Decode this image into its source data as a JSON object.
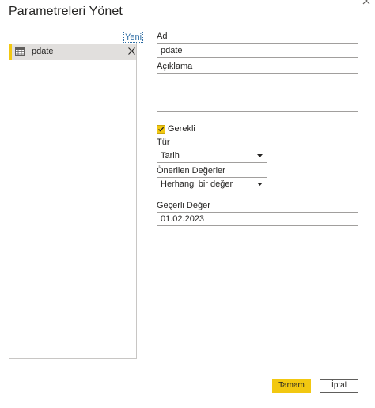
{
  "dialog": {
    "title": "Parametreleri Yönet"
  },
  "list": {
    "new_label": "Yeni",
    "items": [
      {
        "name": "pdate"
      }
    ]
  },
  "form": {
    "name_label": "Ad",
    "name_value": "pdate",
    "description_label": "Açıklama",
    "description_value": "",
    "required_label": "Gerekli",
    "required_checked": true,
    "type_label": "Tür",
    "type_value": "Tarih",
    "suggested_label": "Önerilen Değerler",
    "suggested_value": "Herhangi bir değer",
    "current_label": "Geçerli Değer",
    "current_value": "01.02.2023"
  },
  "buttons": {
    "ok_label": "Tamam",
    "cancel_label": "İptal"
  },
  "colors": {
    "accent": "#f2c811",
    "selected_row": "#e1dfdd",
    "border": "#a19f9d"
  }
}
